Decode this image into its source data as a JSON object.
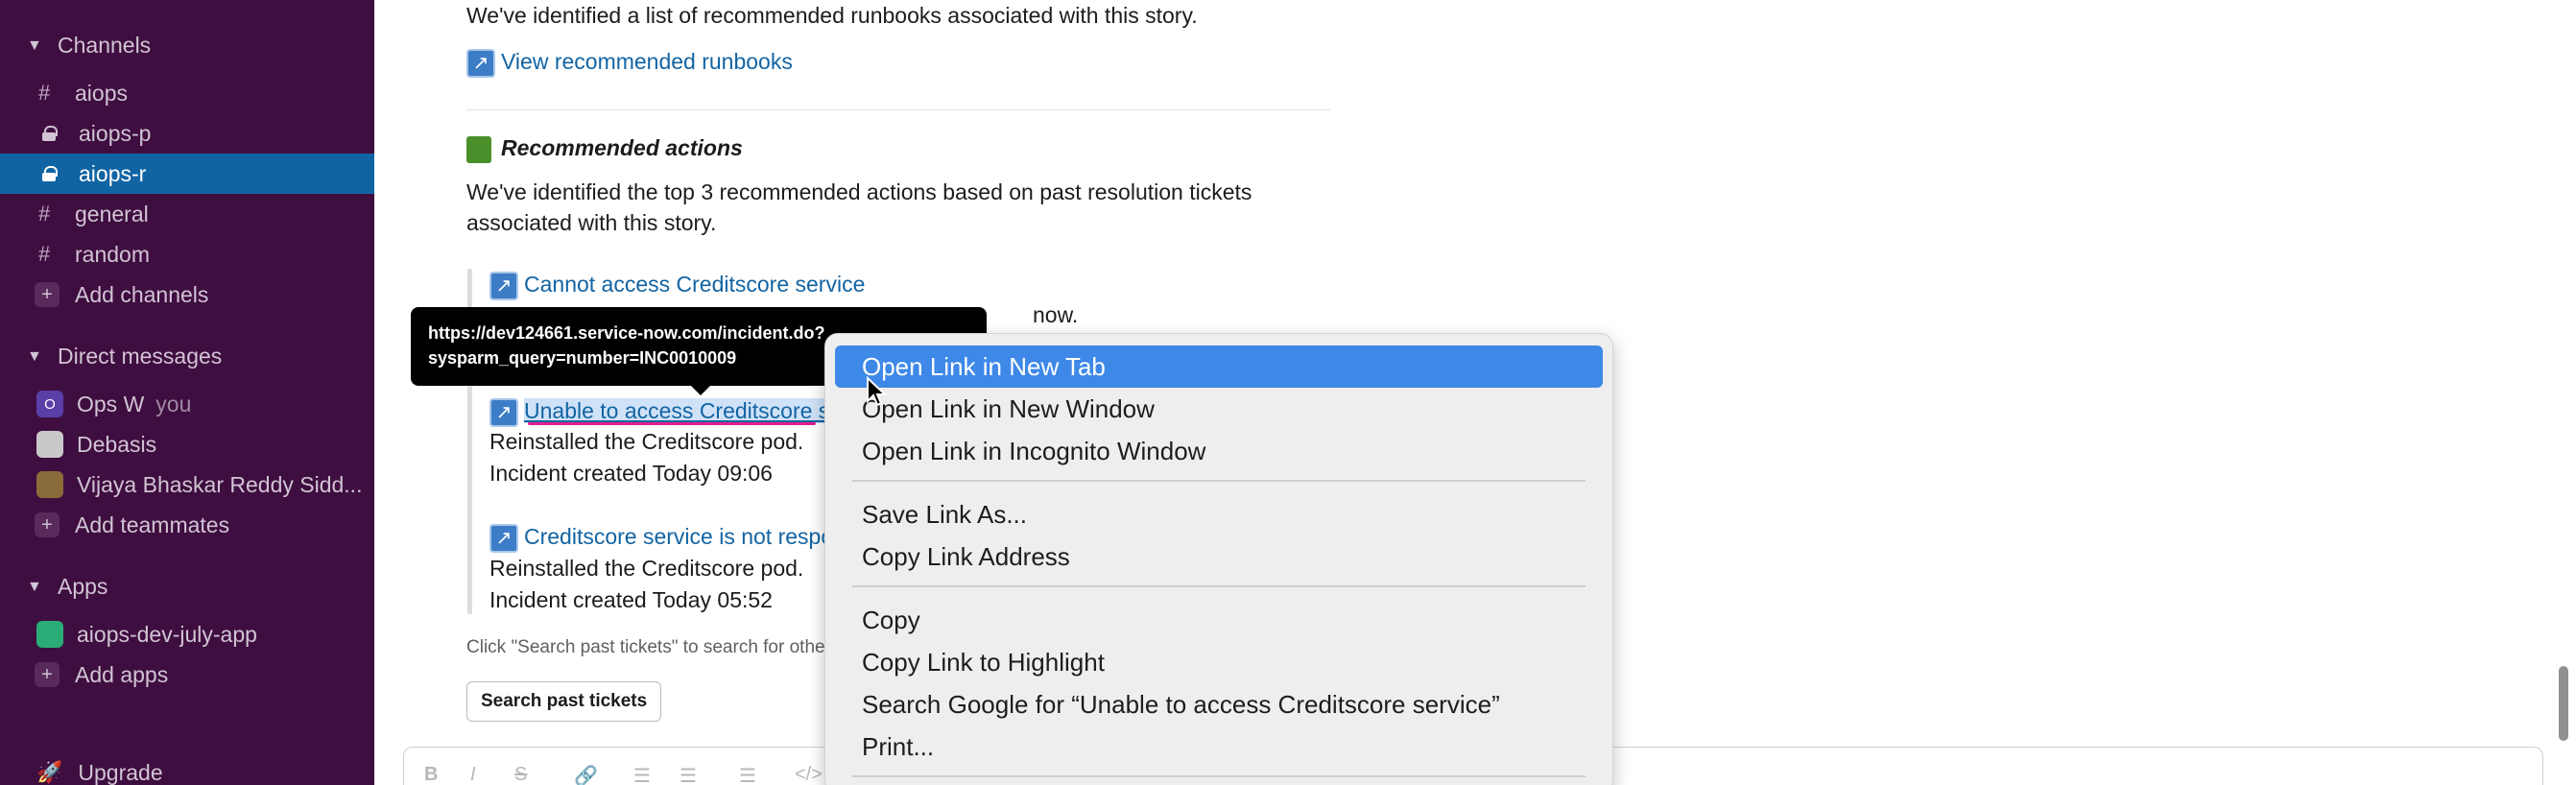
{
  "sidebar": {
    "channels_header": "Channels",
    "channels": [
      {
        "prefix": "#",
        "name": "aiops"
      },
      {
        "prefix": "lock",
        "name": "aiops-p"
      },
      {
        "prefix": "lock",
        "name": "aiops-r",
        "active": true
      },
      {
        "prefix": "#",
        "name": "general"
      },
      {
        "prefix": "#",
        "name": "random"
      }
    ],
    "add_channels": "Add channels",
    "dm_header": "Direct messages",
    "dms": [
      {
        "name": "Ops W",
        "suffix": "you",
        "avatar": "O"
      },
      {
        "name": "Debasis"
      },
      {
        "name": "Vijaya Bhaskar Reddy Sidd..."
      }
    ],
    "add_teammates": "Add teammates",
    "apps_header": "Apps",
    "apps": [
      {
        "name": "aiops-dev-july-app"
      }
    ],
    "add_apps": "Add apps",
    "upgrade": "Upgrade"
  },
  "message": {
    "runbooks_text": "We've identified a list of recommended runbooks associated with this story.",
    "runbooks_link": "View recommended runbooks",
    "actions_title": "Recommended actions",
    "actions_text_1": "We've identified the top 3 recommended actions based on past resolution tickets",
    "actions_text_2": "associated with this story.",
    "tickets": [
      {
        "title": "Cannot access Creditscore service",
        "line1": "now."
      },
      {
        "title": "Unable to access Creditscore se",
        "line1": "Reinstalled the Creditscore pod.",
        "line2": "Incident created Today 09:06"
      },
      {
        "title": "Creditscore service is not respon",
        "line1": "Reinstalled the Creditscore pod.",
        "line2": "Incident created Today 05:52"
      }
    ],
    "hint": "Click \"Search past tickets\" to search for othe",
    "search_button": "Search past tickets"
  },
  "tooltip": {
    "line1": "https://dev124661.service-now.com/incident.do?",
    "line2": "sysparm_query=number=INC0010009"
  },
  "context_menu": {
    "items": [
      "Open Link in New Tab",
      "Open Link in New Window",
      "Open Link in Incognito Window",
      "Save Link As...",
      "Copy Link Address",
      "Copy",
      "Copy Link to Highlight",
      "Search Google for “Unable to access Creditscore service”",
      "Print..."
    ]
  },
  "colors": {
    "sidebar_bg": "#3f0e40",
    "active_bg": "#1164a3",
    "link": "#1264a3",
    "menu_highlight": "#3e88e8"
  }
}
